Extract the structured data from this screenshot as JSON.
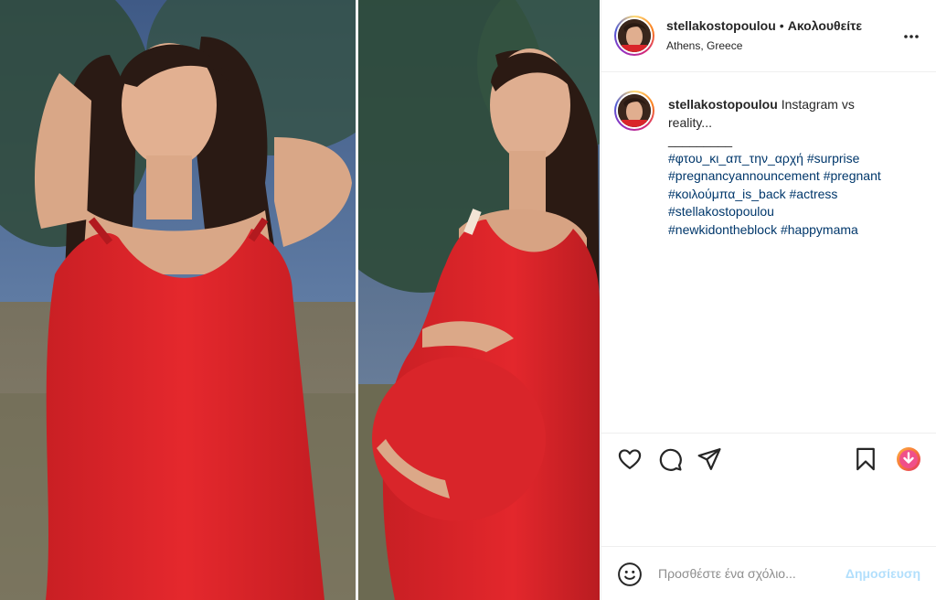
{
  "post": {
    "username": "stellakostopoulou",
    "separator": "•",
    "follow_label": "Ακολουθείτε",
    "location": "Athens, Greece"
  },
  "caption": {
    "username": "stellakostopoulou",
    "text_line1": "Instagram vs",
    "text_line2": "reality...",
    "underline": "_________",
    "hashtags": [
      [
        "#φτου_κι_απ_την_αρχή",
        "#surprise"
      ],
      [
        "#pregnancyannouncement",
        "#pregnant"
      ],
      [
        "#κοιλούμπα_is_back",
        "#actress"
      ],
      [
        "#stellakostopoulou"
      ],
      [
        "#newkidontheblock",
        "#happymama"
      ]
    ]
  },
  "actions": {
    "icons": [
      "heart-icon",
      "comment-icon",
      "share-icon",
      "bookmark-icon",
      "download-icon"
    ]
  },
  "comment_box": {
    "placeholder": "Προσθέστε ένα σχόλιο...",
    "post_label": "Δημοσίευση"
  },
  "colors": {
    "hashtag": "#00376b",
    "post_button_disabled": "#b2dffc",
    "dress": "#e0262b",
    "download_badge": "#f0508a"
  }
}
